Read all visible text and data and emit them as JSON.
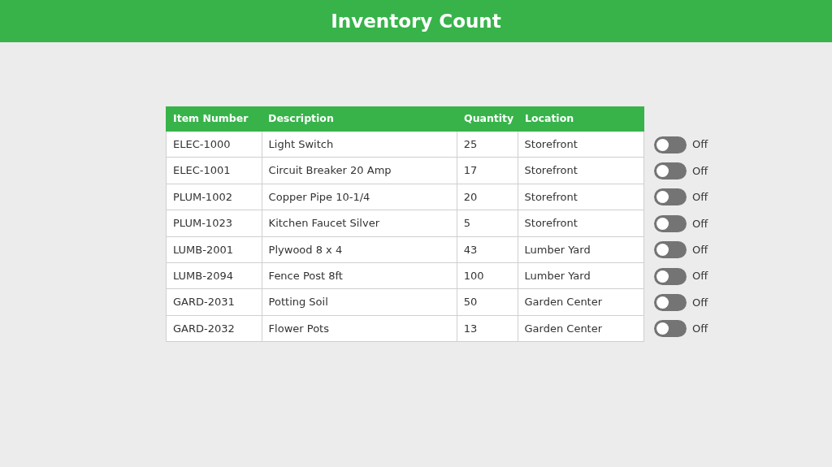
{
  "header": {
    "title": "Inventory Count"
  },
  "table": {
    "columns": [
      "Item Number",
      "Description",
      "Quantity",
      "Location"
    ],
    "rows": [
      {
        "cells": [
          "ELEC-1000",
          "Light Switch",
          "25",
          "Storefront"
        ],
        "toggle": {
          "on": false,
          "label": "Off"
        }
      },
      {
        "cells": [
          "ELEC-1001",
          "Circuit Breaker 20 Amp",
          "17",
          "Storefront"
        ],
        "toggle": {
          "on": false,
          "label": "Off"
        }
      },
      {
        "cells": [
          "PLUM-1002",
          "Copper Pipe 10-1/4",
          "20",
          "Storefront"
        ],
        "toggle": {
          "on": false,
          "label": "Off"
        }
      },
      {
        "cells": [
          "PLUM-1023",
          "Kitchen Faucet Silver",
          "5",
          "Storefront"
        ],
        "toggle": {
          "on": false,
          "label": "Off"
        }
      },
      {
        "cells": [
          "LUMB-2001",
          "Plywood 8 x 4",
          "43",
          "Lumber Yard"
        ],
        "toggle": {
          "on": false,
          "label": "Off"
        }
      },
      {
        "cells": [
          "LUMB-2094",
          "Fence Post 8ft",
          "100",
          "Lumber Yard"
        ],
        "toggle": {
          "on": false,
          "label": "Off"
        }
      },
      {
        "cells": [
          "GARD-2031",
          "Potting Soil",
          "50",
          "Garden Center"
        ],
        "toggle": {
          "on": false,
          "label": "Off"
        }
      },
      {
        "cells": [
          "GARD-2032",
          "Flower Pots",
          "13",
          "Garden Center"
        ],
        "toggle": {
          "on": false,
          "label": "Off"
        }
      }
    ]
  }
}
